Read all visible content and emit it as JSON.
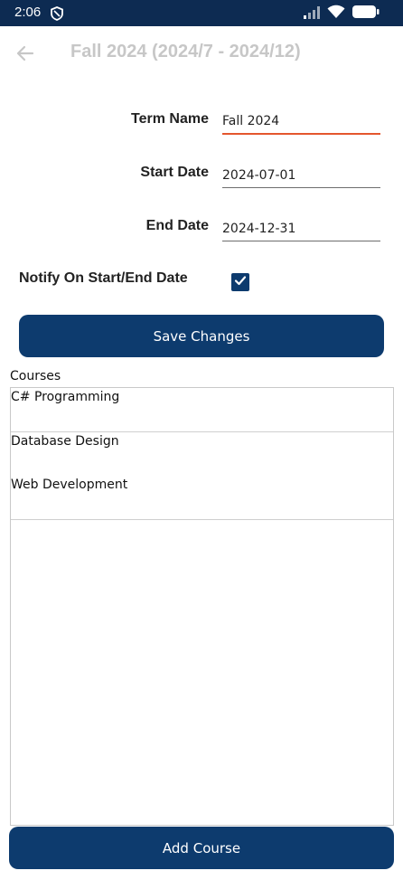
{
  "status_bar": {
    "time": "2:06",
    "icons": [
      "shield-icon",
      "signal-icon",
      "wifi-icon",
      "battery-icon"
    ]
  },
  "app_bar": {
    "title": "Fall 2024 (2024/7 - 2024/12)",
    "back_icon": "arrow-left-icon"
  },
  "form": {
    "term_name_label": "Term Name",
    "term_name_value": "Fall 2024",
    "start_date_label": "Start Date",
    "start_date_value": "2024-07-01",
    "end_date_label": "End Date",
    "end_date_value": "2024-12-31",
    "notify_label": "Notify On Start/End Date",
    "notify_checked": true,
    "save_label": "Save Changes"
  },
  "courses": {
    "heading": "Courses",
    "items": [
      "C# Programming",
      "Database Design",
      "Web Development"
    ],
    "add_label": "Add Course"
  },
  "colors": {
    "status_bar": "#0d2b52",
    "primary": "#0d3b6e",
    "focus_underline": "#e4562e",
    "title_text": "#c7c7c7"
  }
}
